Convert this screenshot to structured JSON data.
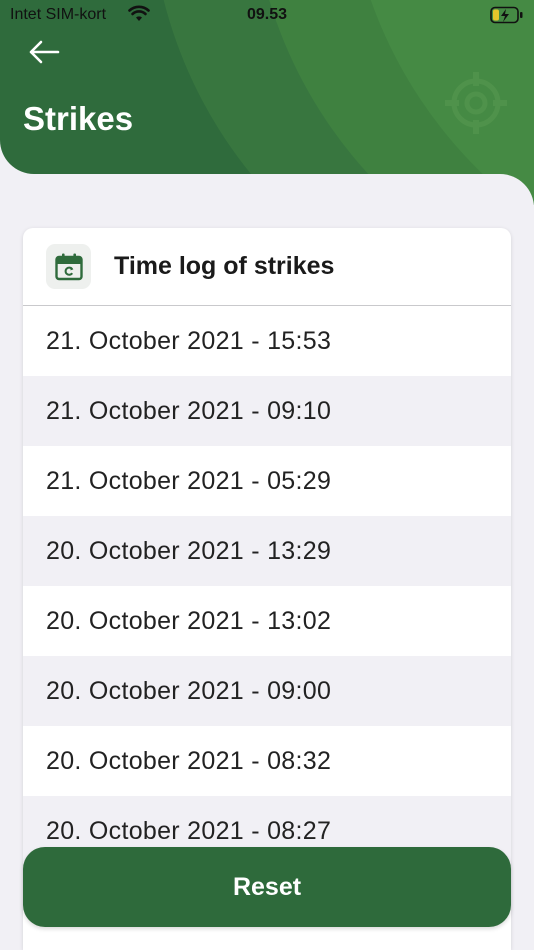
{
  "status_bar": {
    "carrier": "Intet SIM-kort",
    "time": "09.53"
  },
  "header": {
    "title": "Strikes",
    "back_icon": "arrow-left-icon",
    "decor_icon": "crosshair-icon"
  },
  "card": {
    "icon": "calendar-icon",
    "title": "Time log of strikes",
    "entries": [
      "21. October 2021 - 15:53",
      "21. October 2021 - 09:10",
      "21. October 2021 - 05:29",
      "20. October 2021 - 13:29",
      "20. October 2021 - 13:02",
      "20. October 2021 - 09:00",
      "20. October 2021 - 08:32",
      "20. October 2021 - 08:27"
    ]
  },
  "actions": {
    "reset_label": "Reset"
  },
  "colors": {
    "brand_green": "#2f6b3c",
    "button_green": "#2e6a3b",
    "background": "#f1f0f5"
  }
}
